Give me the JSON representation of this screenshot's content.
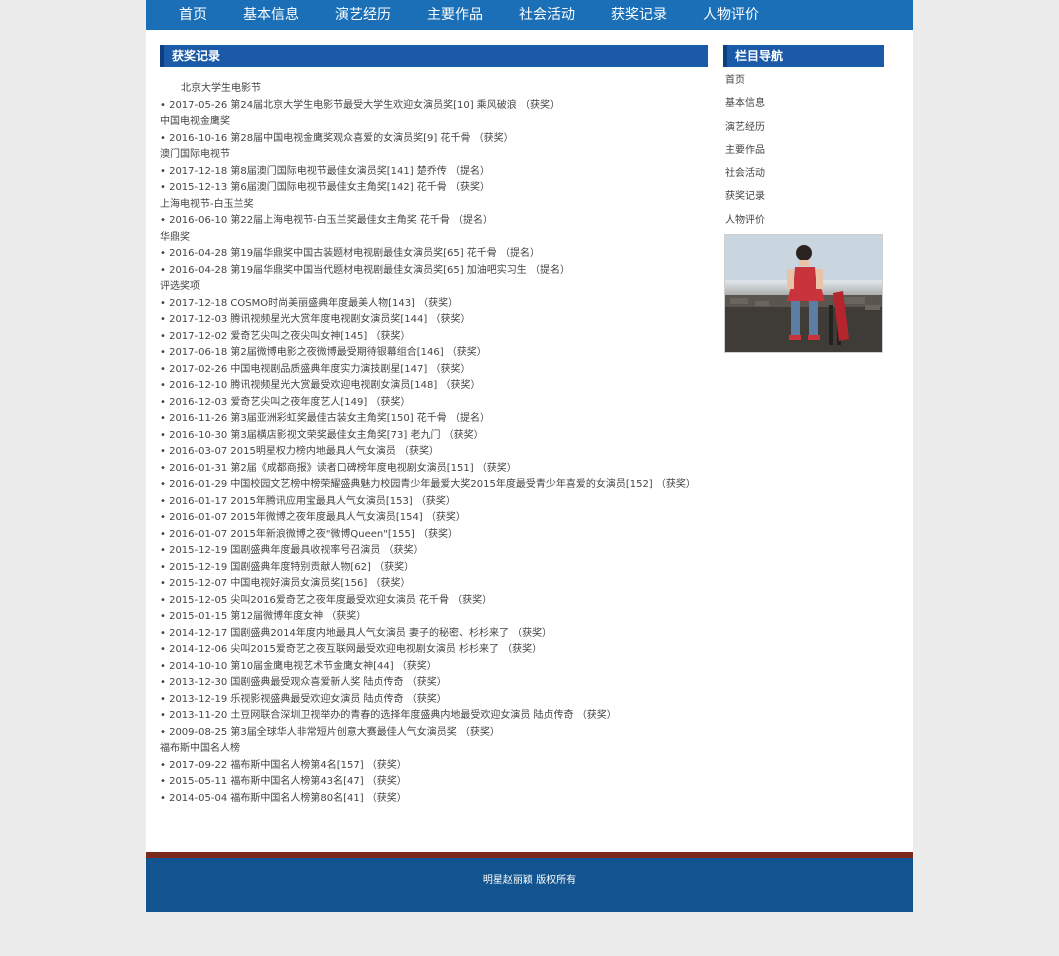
{
  "nav": [
    "首页",
    "基本信息",
    "演艺经历",
    "主要作品",
    "社会活动",
    "获奖记录",
    "人物评价"
  ],
  "main": {
    "title": "获奖记录",
    "entries": [
      {
        "kind": "group",
        "text": "北京大学生电影节",
        "indent": true
      },
      {
        "kind": "item",
        "text": "• 2017-05-26 第24届北京大学生电影节最受大学生欢迎女演员奖[10] 乘风破浪 （获奖）"
      },
      {
        "kind": "group",
        "text": "中国电视金鹰奖"
      },
      {
        "kind": "item",
        "text": "• 2016-10-16 第28届中国电视金鹰奖观众喜爱的女演员奖[9] 花千骨 （获奖）"
      },
      {
        "kind": "group",
        "text": "澳门国际电视节"
      },
      {
        "kind": "item",
        "text": "• 2017-12-18 第8届澳门国际电视节最佳女演员奖[141] 楚乔传 （提名）"
      },
      {
        "kind": "item",
        "text": "• 2015-12-13 第6届澳门国际电视节最佳女主角奖[142] 花千骨 （获奖）"
      },
      {
        "kind": "group",
        "text": "上海电视节-白玉兰奖"
      },
      {
        "kind": "item",
        "text": "• 2016-06-10 第22届上海电视节-白玉兰奖最佳女主角奖 花千骨 （提名）"
      },
      {
        "kind": "group",
        "text": "华鼎奖"
      },
      {
        "kind": "item",
        "text": "• 2016-04-28 第19届华鼎奖中国古装题材电视剧最佳女演员奖[65] 花千骨 （提名）"
      },
      {
        "kind": "item",
        "text": "• 2016-04-28 第19届华鼎奖中国当代题材电视剧最佳女演员奖[65] 加油吧实习生 （提名）"
      },
      {
        "kind": "group",
        "text": "评选奖项"
      },
      {
        "kind": "item",
        "text": "• 2017-12-18 COSMO时尚美丽盛典年度最美人物[143] （获奖）"
      },
      {
        "kind": "item",
        "text": "• 2017-12-03 腾讯视频星光大赏年度电视剧女演员奖[144] （获奖）"
      },
      {
        "kind": "item",
        "text": "• 2017-12-02 爱奇艺尖叫之夜尖叫女神[145] （获奖）"
      },
      {
        "kind": "item",
        "text": "• 2017-06-18 第2届微博电影之夜微博最受期待银幕组合[146] （获奖）"
      },
      {
        "kind": "item",
        "text": "• 2017-02-26 中国电视剧品质盛典年度实力演技剧星[147] （获奖）"
      },
      {
        "kind": "item",
        "text": "• 2016-12-10 腾讯视频星光大赏最受欢迎电视剧女演员[148] （获奖）"
      },
      {
        "kind": "item",
        "text": "• 2016-12-03 爱奇艺尖叫之夜年度艺人[149] （获奖）"
      },
      {
        "kind": "item",
        "text": "• 2016-11-26 第3届亚洲彩虹奖最佳古装女主角奖[150] 花千骨 （提名）"
      },
      {
        "kind": "item",
        "text": "• 2016-10-30 第3届横店影视文荣奖最佳女主角奖[73] 老九门 （获奖）"
      },
      {
        "kind": "item",
        "text": "• 2016-03-07 2015明星权力榜内地最具人气女演员 （获奖）"
      },
      {
        "kind": "item",
        "text": "• 2016-01-31 第2届《成都商报》读者口碑榜年度电视剧女演员[151] （获奖）"
      },
      {
        "kind": "item",
        "text": "• 2016-01-29 中国校园文艺榜中榜荣耀盛典魅力校园青少年最爱大奖2015年度最受青少年喜爱的女演员[152] （获奖）"
      },
      {
        "kind": "item",
        "text": "• 2016-01-17 2015年腾讯应用宝最具人气女演员[153] （获奖）"
      },
      {
        "kind": "item",
        "text": "• 2016-01-07 2015年微博之夜年度最具人气女演员[154] （获奖）"
      },
      {
        "kind": "item",
        "text": "• 2016-01-07 2015年新浪微博之夜\"微博Queen\"[155] （获奖）"
      },
      {
        "kind": "item",
        "text": "• 2015-12-19 国剧盛典年度最具收视率号召演员 （获奖）"
      },
      {
        "kind": "item",
        "text": "• 2015-12-19 国剧盛典年度特别贡献人物[62] （获奖）"
      },
      {
        "kind": "item",
        "text": "• 2015-12-07 中国电视好演员女演员奖[156] （获奖）"
      },
      {
        "kind": "item",
        "text": "• 2015-12-05 尖叫2016爱奇艺之夜年度最受欢迎女演员 花千骨 （获奖）"
      },
      {
        "kind": "item",
        "text": "• 2015-01-15 第12届微博年度女神 （获奖）"
      },
      {
        "kind": "item",
        "text": "• 2014-12-17 国剧盛典2014年度内地最具人气女演员 妻子的秘密、杉杉来了 （获奖）"
      },
      {
        "kind": "item",
        "text": "• 2014-12-06 尖叫2015爱奇艺之夜互联网最受欢迎电视剧女演员 杉杉来了 （获奖）"
      },
      {
        "kind": "item",
        "text": "• 2014-10-10 第10届金鹰电视艺术节金鹰女神[44] （获奖）"
      },
      {
        "kind": "item",
        "text": "• 2013-12-30 国剧盛典最受观众喜爱新人奖 陆贞传奇 （获奖）"
      },
      {
        "kind": "item",
        "text": "• 2013-12-19 乐视影视盛典最受欢迎女演员 陆贞传奇 （获奖）"
      },
      {
        "kind": "item",
        "text": "• 2013-11-20 土豆网联合深圳卫视举办的青春的选择年度盛典内地最受欢迎女演员 陆贞传奇 （获奖）"
      },
      {
        "kind": "item",
        "text": "• 2009-08-25 第3届全球华人非常短片创意大赛最佳人气女演员奖 （获奖）"
      },
      {
        "kind": "group",
        "text": "福布斯中国名人榜"
      },
      {
        "kind": "item",
        "text": "• 2017-09-22 福布斯中国名人榜第4名[157] （获奖）"
      },
      {
        "kind": "item",
        "text": "• 2015-05-11 福布斯中国名人榜第43名[47] （获奖）"
      },
      {
        "kind": "item",
        "text": "• 2014-05-04 福布斯中国名人榜第80名[41] （获奖）"
      }
    ]
  },
  "sidebar": {
    "title": "栏目导航",
    "items": [
      "首页",
      "基本信息",
      "演艺经历",
      "主要作品",
      "社会活动",
      "获奖记录",
      "人物评价"
    ]
  },
  "footer": {
    "text": "明星赵丽颖 版权所有"
  }
}
